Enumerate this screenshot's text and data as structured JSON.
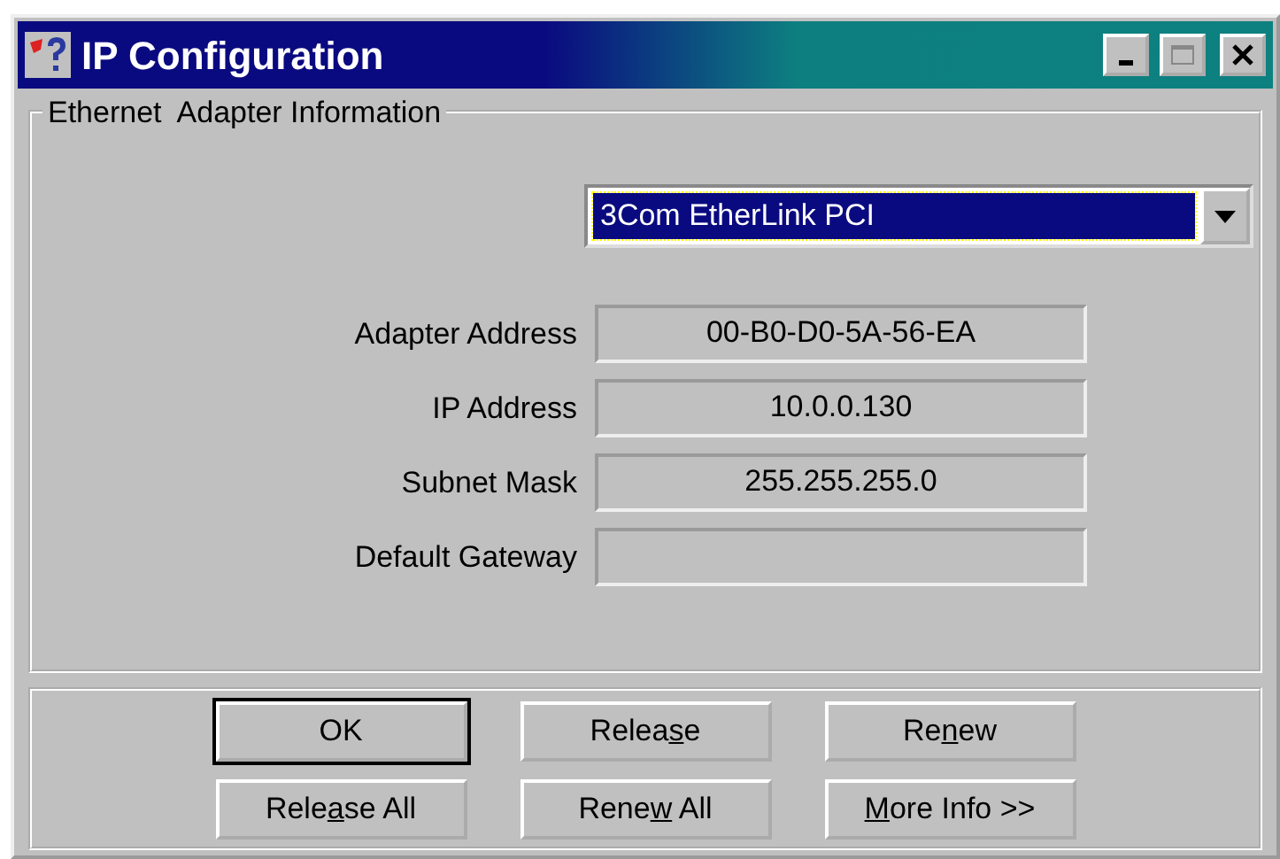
{
  "window": {
    "title": "IP Configuration"
  },
  "group": {
    "title": "Ethernet  Adapter Information"
  },
  "adapter_select": {
    "value": "3Com EtherLink PCI",
    "selected": true
  },
  "fields": [
    {
      "label": "Adapter Address",
      "value": "00-B0-D0-5A-56-EA"
    },
    {
      "label": "IP Address",
      "value": "10.0.0.130"
    },
    {
      "label": "Subnet Mask",
      "value": "255.255.255.0"
    },
    {
      "label": "Default Gateway"
    }
  ],
  "buttons": [
    {
      "label_start": "OK",
      "default": true
    },
    {
      "label_start": "Relea",
      "access_key": "s",
      "label_end": "e",
      "default": false
    },
    {
      "label_start": "Re",
      "access_key": "n",
      "label_end": "ew",
      "default": false
    },
    {
      "label_start": "Rele",
      "access_key": "a",
      "label_end": "se All",
      "default": false
    },
    {
      "label_start": "Rene",
      "access_key": "w",
      "label_end": " All",
      "default": false
    },
    {
      "access_key": "M",
      "label_end": "ore Info >>",
      "default": false
    }
  ]
}
